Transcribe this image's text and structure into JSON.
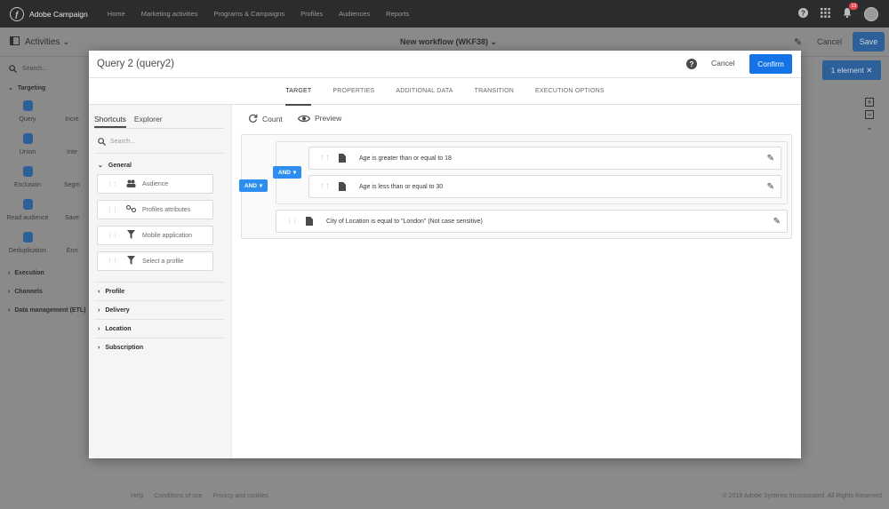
{
  "topnav": {
    "app_name": "Adobe Campaign",
    "logo_glyph": "ƒ",
    "items": [
      "Home",
      "Marketing activities",
      "Programs & Campaigns",
      "Profiles",
      "Audiences",
      "Reports"
    ],
    "notification_count": "13"
  },
  "workflow": {
    "activities_label": "Activities",
    "title": "New workflow (WKF38)",
    "cancel_label": "Cancel",
    "save_label": "Save"
  },
  "palette": {
    "search_placeholder": "Search...",
    "targeting_label": "Targeting",
    "activities": [
      "Query",
      "Incre",
      "Union",
      "Inte",
      "Exclusion",
      "Segm",
      "Read audience",
      "Save",
      "Deduplication",
      "Enri"
    ],
    "sections": [
      "Execution",
      "Channels",
      "Data management (ETL)"
    ]
  },
  "canvas": {
    "element_label": "1 element"
  },
  "footer": {
    "links": [
      "Help",
      "Conditions of use",
      "Privacy and cookies"
    ],
    "copyright": "© 2018 Adobe Systems Incorporated. All Rights Reserved"
  },
  "modal": {
    "title": "Query 2 (query2)",
    "cancel_label": "Cancel",
    "confirm_label": "Confirm",
    "tabs": [
      "TARGET",
      "PROPERTIES",
      "ADDITIONAL DATA",
      "TRANSITION",
      "EXECUTION OPTIONS"
    ],
    "active_tab": "TARGET",
    "left": {
      "tabs": [
        "Shortcuts",
        "Explorer"
      ],
      "search_placeholder": "Search...",
      "general_label": "General",
      "shortcuts": [
        "Audience",
        "Profiles attributes",
        "Mobile application",
        "Select a profile"
      ],
      "groups": [
        "Profile",
        "Delivery",
        "Location",
        "Subscription"
      ]
    },
    "toolbar": {
      "count_label": "Count",
      "preview_label": "Preview"
    },
    "rules": {
      "outer_operator": "AND",
      "inner_operator": "AND",
      "conditions": [
        "Age is greater than or equal to 18",
        "Age is less than or equal to 30",
        "City of Location is equal to \"London\" (Not case sensitive)"
      ]
    }
  }
}
